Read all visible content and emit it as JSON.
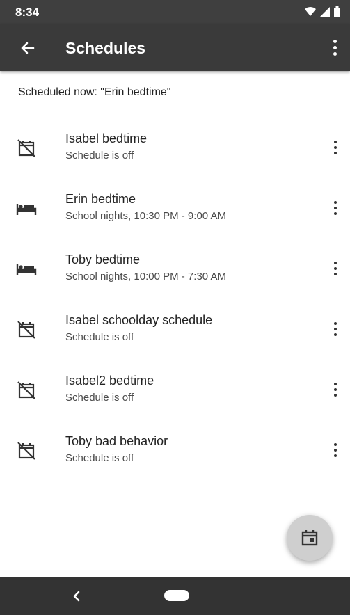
{
  "status_bar": {
    "time": "8:34",
    "icons": [
      "wifi-icon",
      "cell-signal-icon",
      "battery-icon"
    ]
  },
  "app_bar": {
    "title": "Schedules",
    "back_icon": "arrow-back-icon",
    "menu_icon": "more-vert-icon"
  },
  "scheduled_now": "Scheduled now: \"Erin bedtime\"",
  "schedules": [
    {
      "title": "Isabel bedtime",
      "subtitle": "Schedule is off",
      "icon": "calendar-off-icon"
    },
    {
      "title": "Erin bedtime",
      "subtitle": "School nights, 10:30 PM - 9:00 AM",
      "icon": "bed-icon"
    },
    {
      "title": "Toby bedtime",
      "subtitle": "School nights, 10:00 PM - 7:30 AM",
      "icon": "bed-icon"
    },
    {
      "title": "Isabel schoolday schedule",
      "subtitle": "Schedule is off",
      "icon": "calendar-off-icon"
    },
    {
      "title": "Isabel2 bedtime",
      "subtitle": "Schedule is off",
      "icon": "calendar-off-icon"
    },
    {
      "title": "Toby bad behavior",
      "subtitle": "Schedule is off",
      "icon": "calendar-off-icon"
    }
  ],
  "fab": {
    "icon": "calendar-add-icon"
  },
  "nav_bar": {
    "back_icon": "nav-back-icon",
    "home_icon": "home-pill-icon"
  },
  "colors": {
    "app_bar": "#3a3a3a",
    "status_bar": "#3f3f3f",
    "nav_bar": "#333333",
    "fab": "#cfcfcf"
  }
}
